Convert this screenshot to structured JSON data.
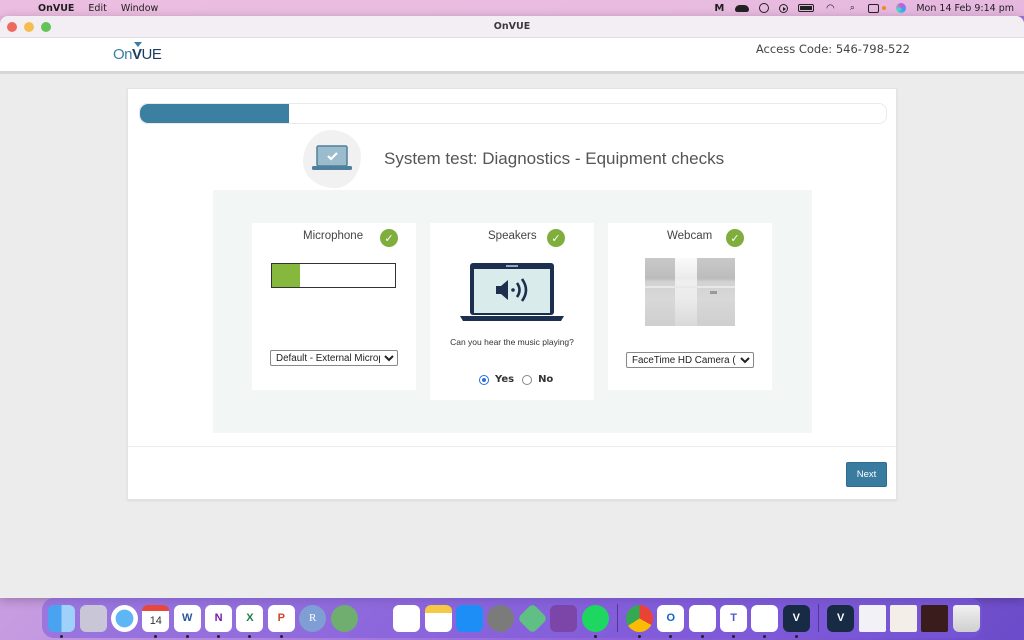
{
  "menubar": {
    "app_name": "OnVUE",
    "menus": [
      "Edit",
      "Window"
    ],
    "status_icons": [
      "malwarebytes-icon",
      "creative-cloud-icon",
      "sync-icon",
      "media-play-icon",
      "battery-icon",
      "wifi-icon",
      "spotlight-search-icon",
      "control-center-icon",
      "siri-icon"
    ],
    "clock": "Mon 14 Feb  9:14 pm"
  },
  "window": {
    "title": "OnVUE"
  },
  "header": {
    "logo": {
      "on": "On",
      "v": "V",
      "ue": "UE"
    },
    "access_code": "Access Code: 546-798-522"
  },
  "progress": {
    "percent": 20
  },
  "page": {
    "title": "System test: Diagnostics - Equipment checks"
  },
  "checks": {
    "microphone": {
      "label": "Microphone",
      "status": "passed",
      "level_percent": 23,
      "device": "Default - External Microphone"
    },
    "speakers": {
      "label": "Speakers",
      "status": "passed",
      "question": "Can you hear the music playing?",
      "options": [
        "Yes",
        "No"
      ],
      "selected": "Yes"
    },
    "webcam": {
      "label": "Webcam",
      "status": "passed",
      "device": "FaceTime HD Camera (Built-in)"
    }
  },
  "colors": {
    "accent": "#3b7fa1",
    "success": "#7fae3d",
    "mic_level": "#87b83e"
  },
  "footer": {
    "next_label": "Next"
  },
  "dock": {
    "items": [
      {
        "name": "finder",
        "running": true
      },
      {
        "name": "launchpad",
        "running": false
      },
      {
        "name": "safari",
        "running": false
      },
      {
        "name": "calendar",
        "running": true,
        "text": "14"
      },
      {
        "name": "word",
        "running": true,
        "text": "W"
      },
      {
        "name": "onenote",
        "running": true,
        "text": "N"
      },
      {
        "name": "excel",
        "running": true,
        "text": "X"
      },
      {
        "name": "powerpoint",
        "running": true,
        "text": "P"
      },
      {
        "name": "r",
        "running": false,
        "text": "R"
      },
      {
        "name": "atom",
        "running": false
      },
      {
        "name": "vscode",
        "running": false
      },
      {
        "name": "reminders",
        "running": false
      },
      {
        "name": "notes",
        "running": false
      },
      {
        "name": "app-store",
        "running": false
      },
      {
        "name": "system-preferences",
        "running": false
      },
      {
        "name": "local",
        "running": false
      },
      {
        "name": "github-desktop",
        "running": false
      },
      {
        "name": "spotify",
        "running": true
      },
      {
        "name": "chrome",
        "running": true
      },
      {
        "name": "outlook",
        "running": true,
        "text": "O"
      },
      {
        "name": "messenger",
        "running": true
      },
      {
        "name": "teams",
        "running": true,
        "text": "T"
      },
      {
        "name": "slack",
        "running": true
      },
      {
        "name": "onvue",
        "running": true,
        "text": "V"
      },
      {
        "name": "onvue-download",
        "running": false,
        "text": "V"
      },
      {
        "name": "recent-document-1",
        "running": false
      },
      {
        "name": "recent-spreadsheet",
        "running": false
      },
      {
        "name": "recent-spotify-window",
        "running": false
      },
      {
        "name": "trash",
        "running": false
      }
    ]
  }
}
